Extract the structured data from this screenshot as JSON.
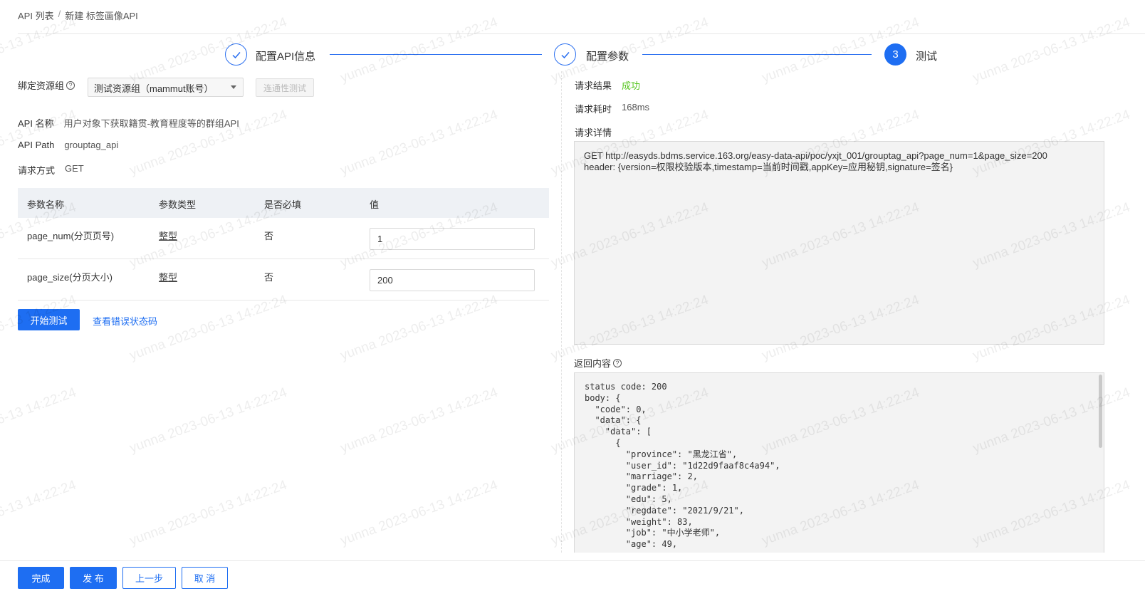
{
  "breadcrumb": {
    "parent": "API 列表",
    "separator": "/",
    "current": "新建 标签画像API"
  },
  "steps": [
    {
      "label": "配置API信息",
      "status": "done"
    },
    {
      "label": "配置参数",
      "status": "done"
    },
    {
      "label": "测试",
      "status": "active",
      "number": "3"
    }
  ],
  "resource_group": {
    "label": "绑定资源组",
    "selected": "测试资源组（mammut账号）",
    "test_button": "连通性测试"
  },
  "api_info": {
    "name_label": "API 名称",
    "name_value": "用户对象下获取籍贯-教育程度等的群组API",
    "path_label": "API Path",
    "path_value": "grouptag_api",
    "method_label": "请求方式",
    "method_value": "GET"
  },
  "param_table": {
    "headers": [
      "参数名称",
      "参数类型",
      "是否必填",
      "值"
    ],
    "rows": [
      {
        "name": "page_num(分页页号)",
        "type": "整型",
        "required": "否",
        "value": "1"
      },
      {
        "name": "page_size(分页大小)",
        "type": "整型",
        "required": "否",
        "value": "200"
      }
    ]
  },
  "actions": {
    "start_test": "开始测试",
    "view_error_codes": "查看错误状态码"
  },
  "result": {
    "result_label": "请求结果",
    "result_value": "成功",
    "time_label": "请求耗时",
    "time_value": "168ms",
    "detail_label": "请求详情",
    "detail_line1": "GET http://easyds.bdms.service.163.org/easy-data-api/poc/yxjt_001/grouptag_api?page_num=1&page_size=200",
    "detail_line2": "header: {version=权限校验版本,timestamp=当前时间戳,appKey=应用秘钥,signature=签名}",
    "return_label": "返回内容",
    "return_content": "status code: 200\nbody: {\n  \"code\": 0,\n  \"data\": {\n    \"data\": [\n      {\n        \"province\": \"黑龙江省\",\n        \"user_id\": \"1d22d9faaf8c4a94\",\n        \"marriage\": 2,\n        \"grade\": 1,\n        \"edu\": 5,\n        \"regdate\": \"2021/9/21\",\n        \"weight\": 83,\n        \"job\": \"中小学老师\",\n        \"age\": 49,"
  },
  "footer": {
    "finish": "完成",
    "publish": "发 布",
    "prev": "上一步",
    "cancel": "取 消"
  },
  "watermark": "yunna 2023-06-13 14:22:24",
  "colors": {
    "primary": "#1e6ef2",
    "success": "#52c41a"
  }
}
